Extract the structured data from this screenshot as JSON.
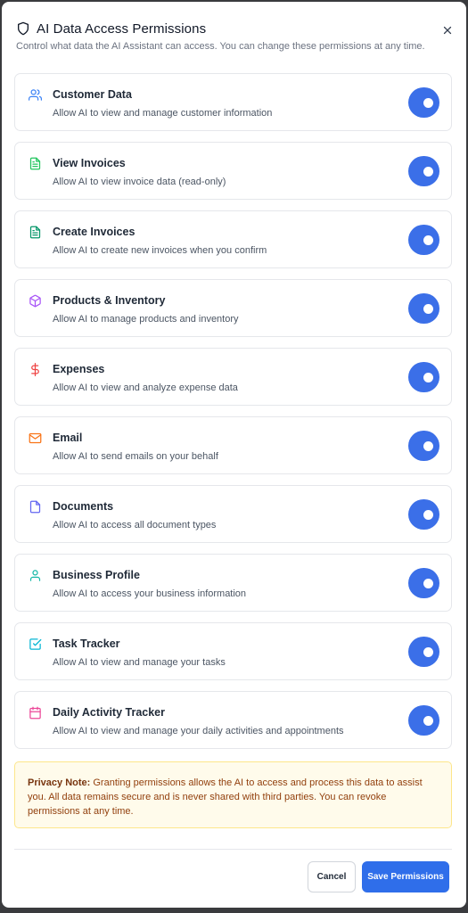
{
  "dialog": {
    "title": "AI Data Access Permissions",
    "subtitle": "Control what data the AI Assistant can access. You can change these permissions at any time.",
    "title_icon": "shield-icon",
    "close_icon": "close-icon"
  },
  "permissions": [
    {
      "id": "customer-data",
      "label": "Customer Data",
      "description": "Allow AI to view and manage customer information",
      "icon": "users-icon",
      "icon_color": "#3b82f6",
      "enabled": true
    },
    {
      "id": "view-invoices",
      "label": "View Invoices",
      "description": "Allow AI to view invoice data (read-only)",
      "icon": "file-text-icon",
      "icon_color": "#22c55e",
      "enabled": true
    },
    {
      "id": "create-invoices",
      "label": "Create Invoices",
      "description": "Allow AI to create new invoices when you confirm",
      "icon": "file-text-icon",
      "icon_color": "#059669",
      "enabled": true
    },
    {
      "id": "products-inventory",
      "label": "Products & Inventory",
      "description": "Allow AI to manage products and inventory",
      "icon": "package-icon",
      "icon_color": "#a855f7",
      "enabled": true
    },
    {
      "id": "expenses",
      "label": "Expenses",
      "description": "Allow AI to view and analyze expense data",
      "icon": "dollar-sign-icon",
      "icon_color": "#ef4444",
      "enabled": true
    },
    {
      "id": "email",
      "label": "Email",
      "description": "Allow AI to send emails on your behalf",
      "icon": "mail-icon",
      "icon_color": "#f97316",
      "enabled": true
    },
    {
      "id": "documents",
      "label": "Documents",
      "description": "Allow AI to access all document types",
      "icon": "file-icon",
      "icon_color": "#6366f1",
      "enabled": true
    },
    {
      "id": "business-profile",
      "label": "Business Profile",
      "description": "Allow AI to access your business information",
      "icon": "user-icon",
      "icon_color": "#14b8a6",
      "enabled": true
    },
    {
      "id": "task-tracker",
      "label": "Task Tracker",
      "description": "Allow AI to view and manage your tasks",
      "icon": "check-square-icon",
      "icon_color": "#06b6d4",
      "enabled": true
    },
    {
      "id": "daily-activity-tracker",
      "label": "Daily Activity Tracker",
      "description": "Allow AI to view and manage your daily activities and appointments",
      "icon": "calendar-icon",
      "icon_color": "#ec4899",
      "enabled": true
    }
  ],
  "privacy_note": {
    "label": "Privacy Note:",
    "text": " Granting permissions allows the AI to access and process this data to assist you. All data remains secure and is never shared with third parties. You can revoke permissions at any time."
  },
  "footer": {
    "cancel_label": "Cancel",
    "save_label": "Save Permissions"
  },
  "colors": {
    "toggle_on": "#3b6fe8",
    "primary_button": "#2f6eea",
    "note_background": "#fffbeb",
    "note_text": "#92400e"
  }
}
